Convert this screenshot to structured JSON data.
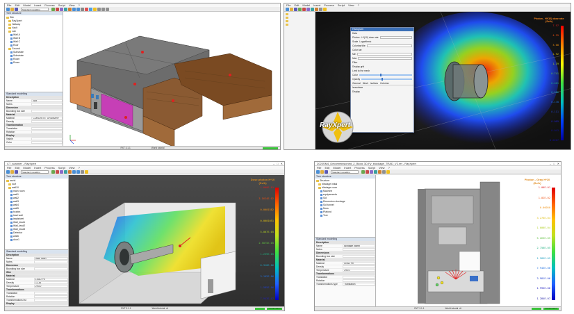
{
  "panel1": {
    "title": "",
    "menu": [
      "File",
      "Edit",
      "Model",
      "Insert",
      "Process",
      "Script",
      "View",
      "?"
    ],
    "toolbar_select": "Standard modelling",
    "tree_header": "Tree structure",
    "tree": [
      "Site",
      "RayXpert",
      "Hallway",
      "Vault",
      "Lab",
      "Wall A",
      "Wall B",
      "Wall C",
      "Roof",
      "Ground",
      "Substrate",
      "Substrate",
      "Room",
      "Room"
    ],
    "props_header": "Standard modelling",
    "props": [
      {
        "k": "Description",
        "v": "",
        "section": true
      },
      {
        "k": "Name",
        "v": "Box"
      },
      {
        "k": "Notes",
        "v": ""
      },
      {
        "k": "Dimension",
        "v": "",
        "section": true
      },
      {
        "k": "Bounding box size",
        "v": ""
      },
      {
        "k": "Material",
        "v": "",
        "section": true
      },
      {
        "k": "Material",
        "v": "CONCRETE_ORDINARY"
      },
      {
        "k": "Density",
        "v": ""
      },
      {
        "k": "Transformation",
        "v": "",
        "section": true
      },
      {
        "k": "Translation",
        "v": ""
      },
      {
        "k": "Rotation",
        "v": ""
      },
      {
        "k": "Display",
        "v": "",
        "section": true
      },
      {
        "k": "Visible",
        "v": ""
      },
      {
        "k": "Color",
        "v": ""
      }
    ],
    "status_center": "RXT 3.1.1",
    "status_right": "World tutorial"
  },
  "panel2": {
    "menu": [
      "File",
      "Edit",
      "Model",
      "Insert",
      "Process",
      "Script",
      "View",
      "?"
    ],
    "dialog_title": "Histogram",
    "dialog_rows": [
      "Data",
      "Photon - H*(10) dose rate",
      "Scale",
      "Logarithmic",
      "Colorbar title",
      "Color bar",
      "Min",
      "Max",
      "Filter",
      "Display grid",
      "Limit to the mesh",
      "Color",
      "Opacity",
      "Isosurface",
      "Display"
    ],
    "tabs": [
      "General",
      "Mesh",
      "Isolines",
      "Colorbar"
    ],
    "logo": "RayXpert",
    "colorbar_title": "Photon - H*(10) dose rate",
    "colorbar_unit": "(Sv/h)",
    "labels": [
      "7.97",
      "4.95",
      "3.08",
      "1.92",
      "1.19",
      "0.741",
      "0.461",
      "0.286",
      "0.178",
      "0.111",
      "0.069",
      "0.043",
      "0.0267"
    ]
  },
  "panel3": {
    "title": "CT_scanner - RayXpert",
    "menu": [
      "File",
      "Edit",
      "Model",
      "Insert",
      "Process",
      "Script",
      "View",
      "?"
    ],
    "toolbar_select": "Standard modelling",
    "tree_header": "Tree structure",
    "tree": [
      "world",
      "roof",
      "wall10",
      "main room",
      "wall1",
      "wall2",
      "wall3",
      "wall4",
      "wall5",
      "hcabin",
      "lead wall",
      "leadsheet",
      "Wall_lead1",
      "Wall_lead2",
      "Wall_lead3",
      "Detector",
      "wall6",
      "door1"
    ],
    "props_header": "Standard modelling",
    "props": [
      {
        "k": "Description",
        "v": "",
        "section": true
      },
      {
        "k": "Name",
        "v": "Wall_sport"
      },
      {
        "k": "Notes",
        "v": ""
      },
      {
        "k": "Dimension",
        "v": "",
        "section": true
      },
      {
        "k": "Bounding box size",
        "v": ""
      },
      {
        "k": "Wire",
        "v": "",
        "section": true
      },
      {
        "k": "Material",
        "v": "",
        "section": true
      },
      {
        "k": "Material",
        "v": "LEAD Pb"
      },
      {
        "k": "Density",
        "v": "11.35"
      },
      {
        "k": "Temperature",
        "v": "293.0"
      },
      {
        "k": "Transformations",
        "v": "",
        "section": true
      },
      {
        "k": "Translation",
        "v": ""
      },
      {
        "k": "Rotation",
        "v": ""
      },
      {
        "k": "Transformations list",
        "v": ""
      },
      {
        "k": "Display",
        "v": "",
        "section": true
      }
    ],
    "colorbar_title": "Dose photon H*10",
    "colorbar_unit": "(Sv/h)",
    "labels": [
      "1.000E-01",
      "3.1624E-02",
      "0.0001582",
      "0.0001051",
      "5.007E-05",
      "2.5075E-05",
      "1.259E-05",
      "6.310E-06",
      "3.162E-06",
      "1.585E-06",
      "7.943E-07"
    ],
    "status_center": "RXT 3.1.1",
    "status_right": "World tutorial .rtt",
    "status_btn": "Confirmation"
  },
  "panel4": {
    "title": "2023SM4_Decommissioned_2_Block 3D-Fy_blockage_TRAD_V2.ret - RayXpert",
    "menu": [
      "File",
      "Edit",
      "Model",
      "Insert",
      "Process",
      "Script",
      "View",
      "?"
    ],
    "toolbar_select": "Standard modelling",
    "tree_header": "Tree structure",
    "tree": [
      "Structure",
      "blindage initial",
      "blindage room",
      "Machine",
      "equipements",
      "Sol",
      "Dimension stockage",
      "Sol tunnel",
      "Murs",
      "Plafond",
      "Tore"
    ],
    "props_header": "Standard modelling",
    "props": [
      {
        "k": "Description",
        "v": "",
        "section": true
      },
      {
        "k": "Name",
        "v": "Blindage plomb"
      },
      {
        "k": "Notes",
        "v": ""
      },
      {
        "k": "Dimensions",
        "v": "",
        "section": true
      },
      {
        "k": "Bounding box size",
        "v": ""
      },
      {
        "k": "Material",
        "v": "",
        "section": true
      },
      {
        "k": "Material",
        "v": "LEAD Pb"
      },
      {
        "k": "Density",
        "v": ""
      },
      {
        "k": "Temperature",
        "v": "293.0"
      },
      {
        "k": "Transformations",
        "v": "",
        "section": true
      },
      {
        "k": "Translation",
        "v": ""
      },
      {
        "k": "Rotation",
        "v": ""
      },
      {
        "k": "Transformations type",
        "v": "Translation"
      }
    ],
    "colorbar_title": "Photon - Gray H*10",
    "colorbar_unit": "(Sv/h)",
    "labels": [
      "1.00E-01",
      "1.02E-02",
      "0.00050",
      "3.276E-04",
      "1.000E-04",
      "5.263E-05",
      "2.756E-05",
      "1.585E-05",
      "7.943E-06",
      "3.981E-06",
      "1.995E-06",
      "1.284E-07"
    ],
    "status_center": "RXT 3.1.1",
    "status_right": "World tutorial .rtt",
    "status_btn": "Confirmation"
  },
  "colors": {
    "accent": "#3b6fb6",
    "status_green": "#39c239",
    "roof_gray": "#6a6a6a",
    "wood": "#8a5a32",
    "magenta_door": "#c63fb6"
  }
}
